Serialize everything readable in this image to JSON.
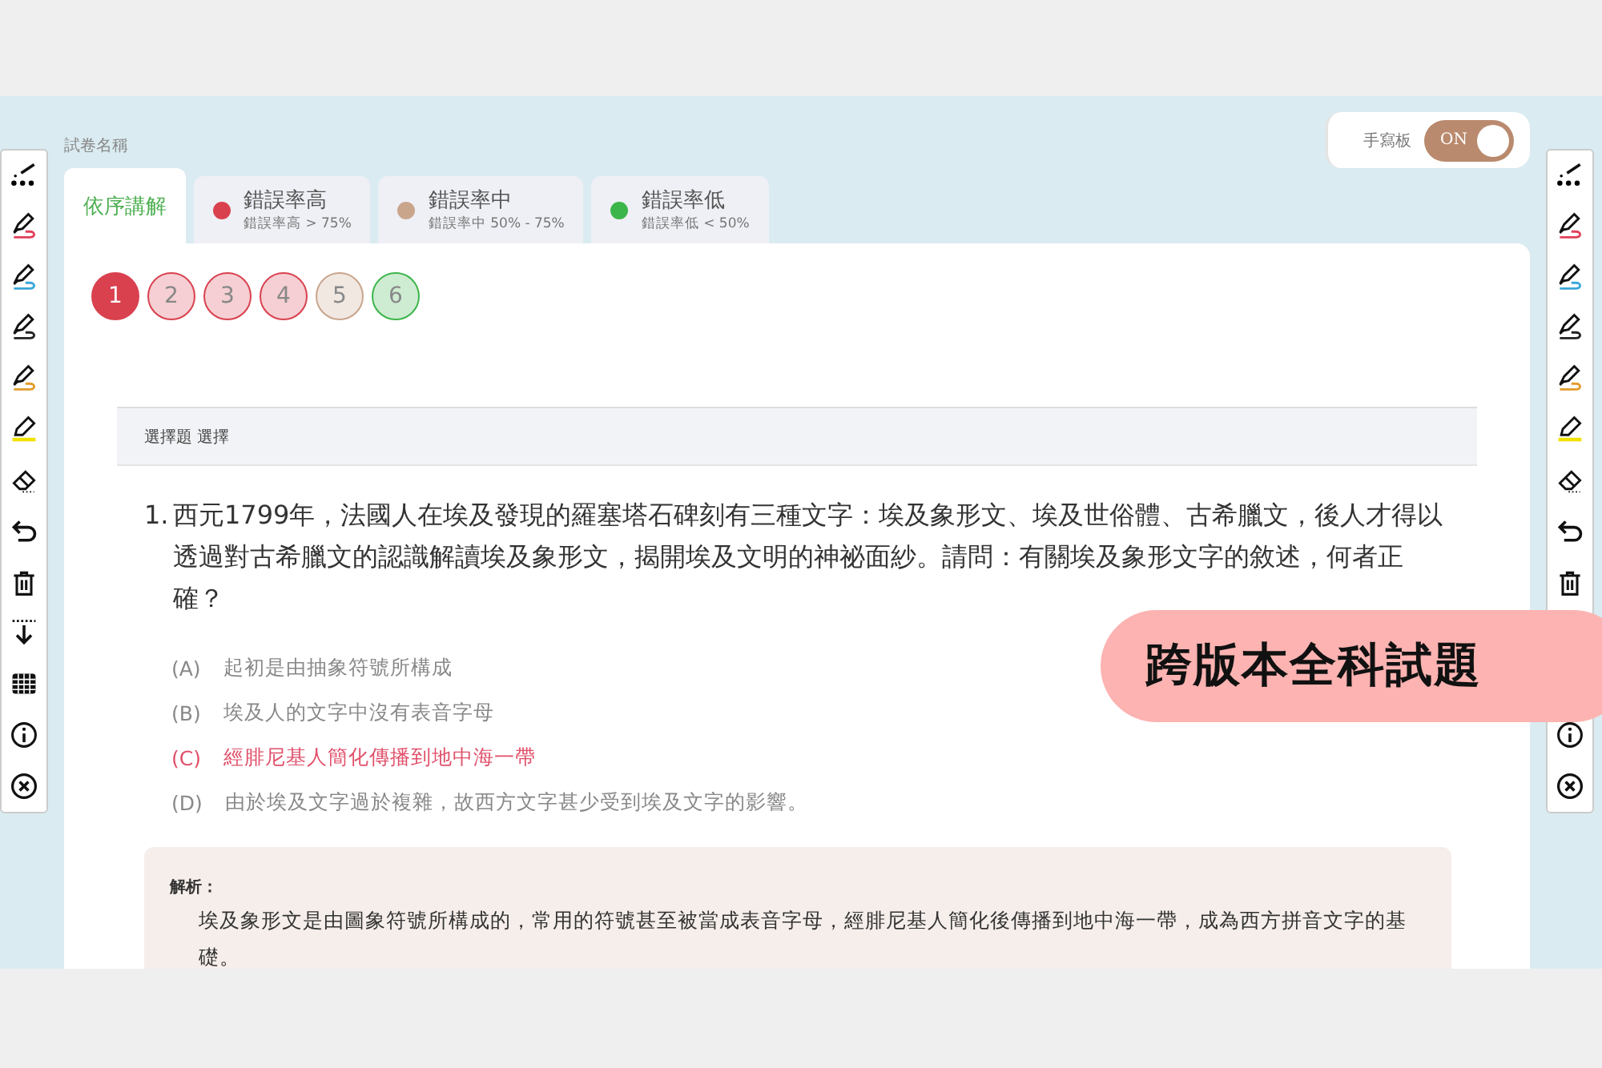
{
  "exam_title": "試卷名稱",
  "handwriting": {
    "label": "手寫板",
    "on": true,
    "state_text": "ON"
  },
  "tabs": [
    {
      "label": "依序講解",
      "selected": true
    },
    {
      "label": "錯誤率高",
      "subtitle": "錯誤率高 > 75%",
      "color": "#d9414f",
      "selected": false
    },
    {
      "label": "錯誤率中",
      "subtitle": "錯誤率中 50% - 75%",
      "color": "#c9a58c",
      "selected": false
    },
    {
      "label": "錯誤率低",
      "subtitle": "錯誤率低 < 50%",
      "color": "#3cb54a",
      "selected": false
    }
  ],
  "question_numbers": [
    {
      "label": "1",
      "color": "#d9414f",
      "selected": true
    },
    {
      "label": "2",
      "color": "#d9414f",
      "selected": false
    },
    {
      "label": "3",
      "color": "#d9414f",
      "selected": false
    },
    {
      "label": "4",
      "color": "#d9414f",
      "selected": false
    },
    {
      "label": "5",
      "color": "#c9a58c",
      "selected": false
    },
    {
      "label": "6",
      "color": "#3cb54a",
      "selected": false
    }
  ],
  "question": {
    "type_label": "選擇題 選擇",
    "number": "1.",
    "text": "西元1799年，法國人在埃及發現的羅塞塔石碑刻有三種文字：埃及象形文、埃及世俗體、古希臘文，後人才得以透過對古希臘文的認識解讀埃及象形文，揭開埃及文明的神祕面紗。請問：有關埃及象形文字的敘述，何者正確？",
    "options": [
      {
        "letter": "(A)",
        "text": "起初是由抽象符號所構成",
        "correct": false
      },
      {
        "letter": "(B)",
        "text": "埃及人的文字中沒有表音字母",
        "correct": false
      },
      {
        "letter": "(C)",
        "text": "經腓尼基人簡化傳播到地中海一帶",
        "correct": true
      },
      {
        "letter": "(D)",
        "text": "由於埃及文字過於複雜，故西方文字甚少受到埃及文字的影響。",
        "correct": false
      }
    ],
    "explanation_label": "解析：",
    "explanation": "埃及象形文是由圖象符號所構成的，常用的符號甚至被當成表音字母，經腓尼基人簡化後傳播到地中海一帶，成為西方拼音文字的基礎。"
  },
  "banner": "跨版本全科試題"
}
